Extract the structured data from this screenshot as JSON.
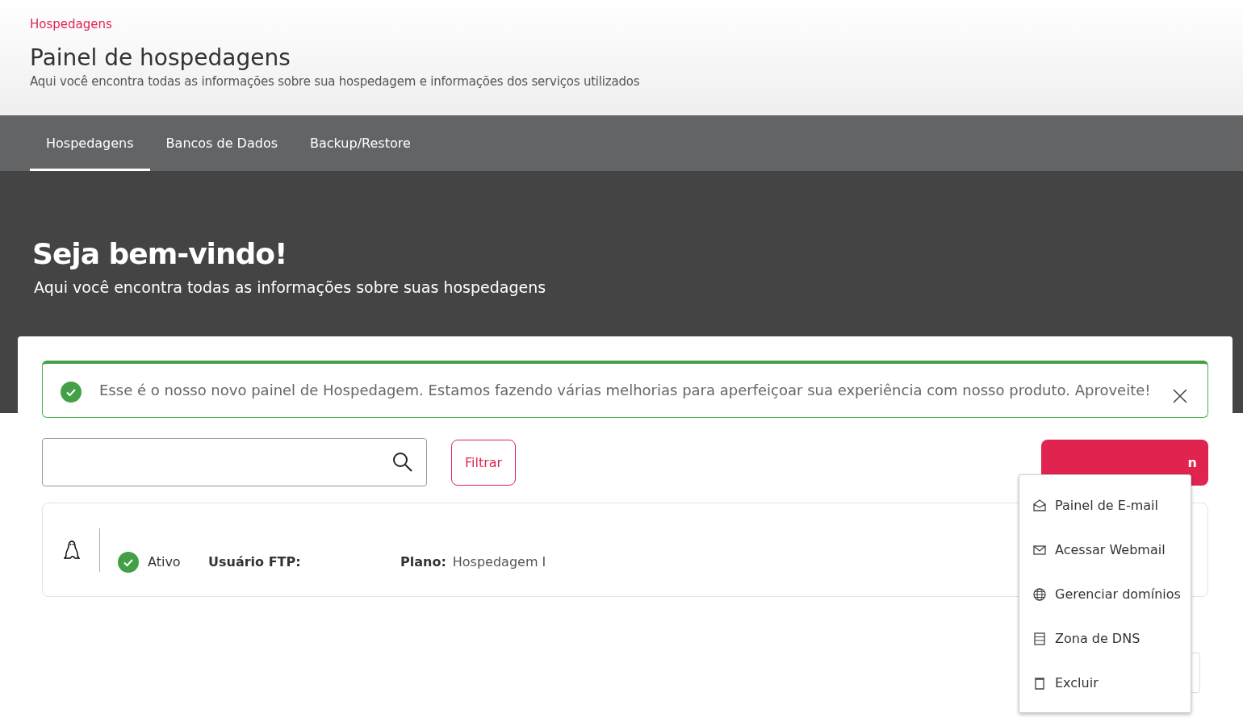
{
  "header": {
    "breadcrumb": "Hospedagens",
    "title": "Painel de hospedagens",
    "subtitle": "Aqui você encontra todas as informações sobre sua hospedagem e informações dos serviços utilizados"
  },
  "tabs": [
    {
      "label": "Hospedagens",
      "selected": true
    },
    {
      "label": "Bancos de Dados",
      "selected": false
    },
    {
      "label": "Backup/Restore",
      "selected": false
    }
  ],
  "hero": {
    "title": "Seja bem-vindo!",
    "subtitle": "Aqui você encontra todas as informações sobre suas hospedagens"
  },
  "alert": {
    "text": "Esse é o nosso novo painel de Hospedagem. Estamos fazendo várias melhorias para aperfeiçoar sua experiência com nosso produto. Aproveite!"
  },
  "toolbar": {
    "filter_button": "Filtrar",
    "primary_button": "n"
  },
  "hosting": {
    "status": "Ativo",
    "ftp_label": "Usuário FTP:",
    "plan_label": "Plano:",
    "plan": "Hospedagem I"
  },
  "menu": [
    {
      "label": "Painel de E-mail",
      "kind": "mail-open"
    },
    {
      "label": "Acessar Webmail",
      "kind": "mail"
    },
    {
      "label": "Gerenciar domínios",
      "kind": "globe"
    },
    {
      "label": "Zona de DNS",
      "kind": "server"
    },
    {
      "label": "Excluir",
      "kind": "trash"
    }
  ]
}
